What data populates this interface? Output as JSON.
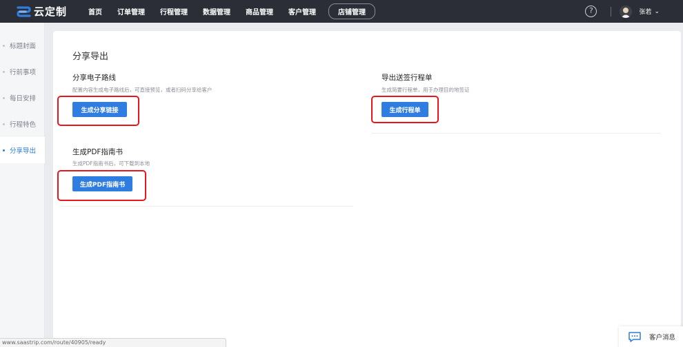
{
  "brand": {
    "name": "云定制"
  },
  "nav": {
    "items": [
      "首页",
      "订单管理",
      "行程管理",
      "数据管理",
      "商品管理",
      "客户管理"
    ],
    "active_item": "店铺管理"
  },
  "header": {
    "help_icon": "help-circle-icon",
    "user_name": "张若"
  },
  "sidebar": {
    "items": [
      {
        "label": "标题封面"
      },
      {
        "label": "行前事项"
      },
      {
        "label": "每日安排"
      },
      {
        "label": "行程特色"
      },
      {
        "label": "分享导出"
      }
    ],
    "active_index": 4
  },
  "main": {
    "title": "分享导出",
    "sections": [
      {
        "title": "分享电子路线",
        "description": "配置内容生成电子路线后，可直接预览，或者扫码分享给客户",
        "button": "生成分享链接"
      },
      {
        "title": "导出送签行程单",
        "description": "生成简要行程单，用于办理目的地签证",
        "button": "生成行程单"
      },
      {
        "title": "生成PDF指南书",
        "description": "生成PDF指南书后，可下载到本地",
        "button": "生成PDF指南书"
      }
    ]
  },
  "status_bar": {
    "url": "www.saastrip.com/route/40905/ready"
  },
  "chat": {
    "label": "客户消息",
    "icon": "chat-bubble-icon"
  },
  "colors": {
    "topbar_bg": "#2b2e36",
    "primary": "#2f7de1",
    "highlight": "#e8151a",
    "active_sidebar": "#2c7ad6"
  }
}
